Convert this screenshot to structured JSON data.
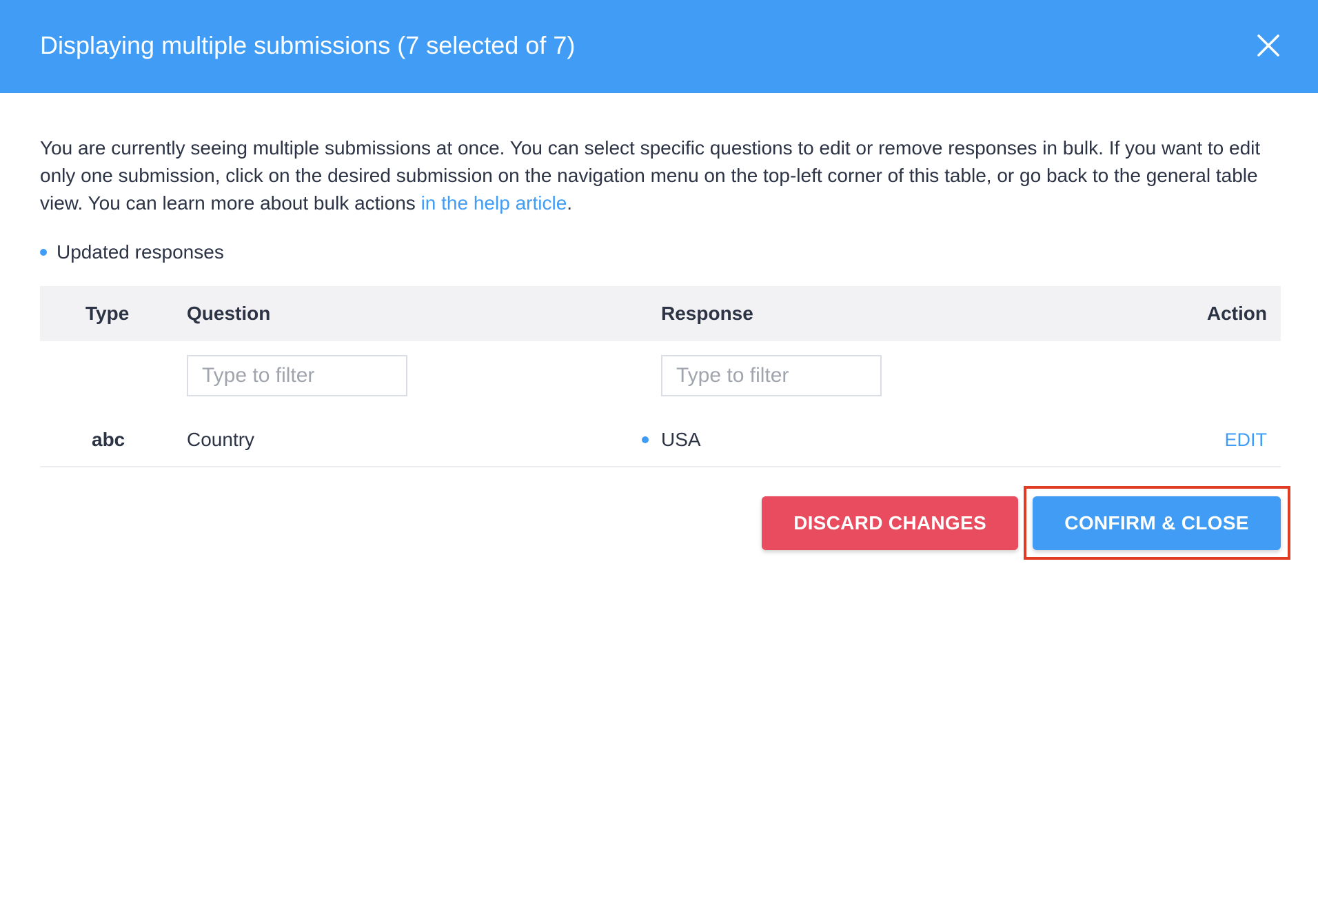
{
  "header": {
    "title": "Displaying multiple submissions (7 selected of 7)",
    "close_icon": "close-icon",
    "bg_color": "#409cf4"
  },
  "description": {
    "text": "You are currently seeing multiple submissions at once. You can select specific questions to edit or remove responses in bulk. If you want to edit only one submission, click on the desired submission on the navigation menu on the top-left corner of this table, or go back to the general table view. You can learn more about bulk actions ",
    "link_text": "in the help article",
    "suffix": "."
  },
  "legend": {
    "label": "Updated responses",
    "dot_color": "#409cf4"
  },
  "table": {
    "columns": {
      "type": "Type",
      "question": "Question",
      "response": "Response",
      "action": "Action"
    },
    "filters": {
      "question_placeholder": "Type to filter",
      "response_placeholder": "Type to filter"
    },
    "rows": [
      {
        "type": "abc",
        "question": "Country",
        "response": "USA",
        "updated": true,
        "action": "EDIT"
      }
    ]
  },
  "buttons": {
    "discard": "DISCARD CHANGES",
    "confirm": "CONFIRM & CLOSE"
  },
  "colors": {
    "accent": "#409cf4",
    "danger": "#e84c5e",
    "highlight": "#e03c24"
  }
}
